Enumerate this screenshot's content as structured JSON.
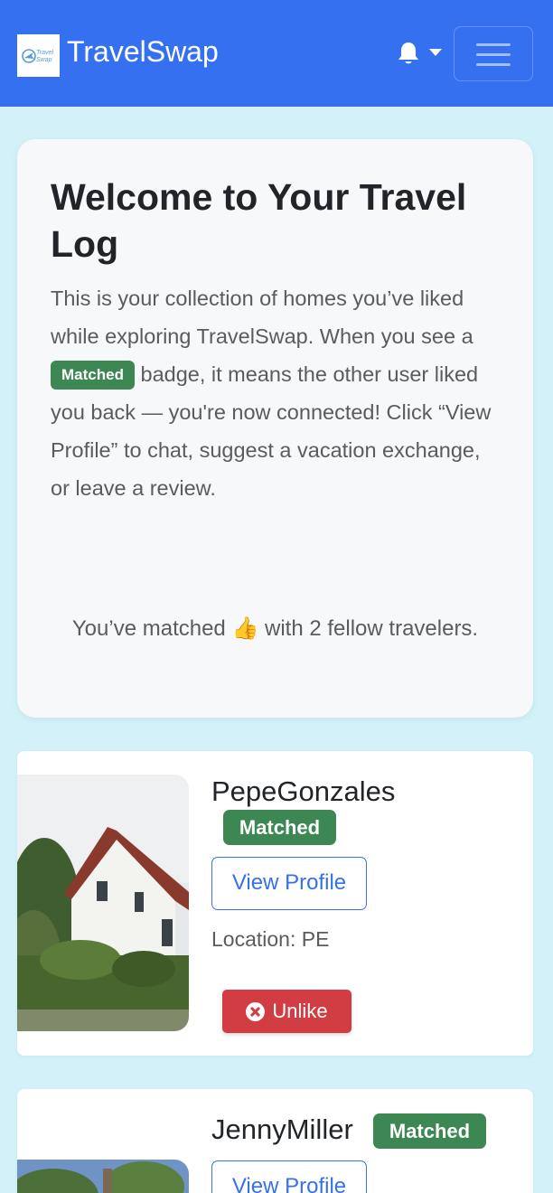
{
  "navbar": {
    "logo_text": "Travel Swap",
    "brand": "TravelSwap",
    "bell_icon": "bell-icon",
    "menu_icon": "hamburger-icon",
    "bg_color": "#3470f0"
  },
  "intro": {
    "title": "Welcome to Your Travel Log",
    "text_before_badge": "This is your collection of homes you’ve liked while exploring TravelSwap. When you see a ",
    "badge": "Matched",
    "text_after_badge": " badge, it means the other user liked you back — you're now connected! Click “View Profile” to chat, suggest a vacation exchange, or leave a review.",
    "match_text_before": "You’ve matched ",
    "match_emoji": "👍",
    "match_text_after": " with 2 fellow travelers."
  },
  "listings": [
    {
      "username": "PepeGonzales",
      "badge": "Matched",
      "view_profile_label": "View Profile",
      "location": "Location: PE",
      "unlike_label": "Unlike"
    },
    {
      "username": "JennyMiller",
      "badge": "Matched",
      "view_profile_label": "View Profile"
    }
  ],
  "colors": {
    "page_bg": "#d3f1f9",
    "matched_badge": "#3d8752",
    "unlike_button": "#d13d43",
    "accent": "#3470f0"
  }
}
